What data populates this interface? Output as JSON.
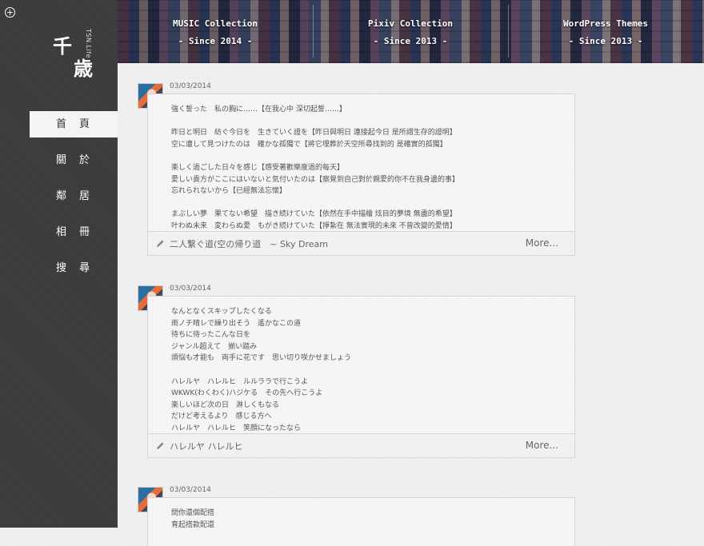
{
  "sidebar": {
    "add_icon": "+",
    "logo": {
      "char1": "千",
      "char2": "歳",
      "sub": "TSN.Life"
    },
    "nav": [
      {
        "label": "首頁",
        "active": true
      },
      {
        "label": "關於",
        "active": false
      },
      {
        "label": "鄰居",
        "active": false
      },
      {
        "label": "相冊",
        "active": false
      },
      {
        "label": "搜尋",
        "active": false
      }
    ]
  },
  "banner": [
    {
      "title": "MUSIC Collection",
      "since": "- Since 2014 -"
    },
    {
      "title": "Pixiv Collection",
      "since": "- Since 2013 -"
    },
    {
      "title": "WordPress Themes",
      "since": "- Since 2013 -"
    }
  ],
  "posts": [
    {
      "date": "03/03/2014",
      "lines": [
        "強く誓った　私の胸に……【在我心中 深切起誓……】",
        "",
        "昨日と明日　紡ぐ今日を　生きていく證を【昨日與明日 連接起今日 是所謂生存的證明】",
        "空に遭して見つけたのは　確かな孤獨で【將它埋葬於天空所尋找到的 是確實的孤獨】",
        "",
        "楽しく過ごした日々を感じ【感受著歡樂度過的每天】",
        "愛しい貴方がここにはいないと気付いたのは【察覺到自己對於親愛的你不在我身邊的事】",
        "忘れられないから【已經無法忘懷】",
        "",
        "まぶしい夢　果てない希望　描き続けていた【依然在手中描繪 炫目的夢境 無盡的希望】",
        "叶わぬ未来　変わらぬ愛　もがき続けていた【掙紮在 無法實現的未來 不曾改變的愛情】"
      ],
      "footer_title": "二人繋ぐ道(空の帰り道　~ Sky Dream",
      "more": "More..."
    },
    {
      "date": "03/03/2014",
      "lines": [
        "なんとなくスキップしたくなる",
        "雨ノチ晴レで繰り出そう　遙かなこの道",
        "待ちに待ったこんな日を",
        "ジャンル超えて　揃い踏み",
        "煩悩も才能も　両手に花です　思い切り咲かせましょう",
        "",
        "ハレルヤ　ハレルヒ　ルルララで行こうよ",
        "WKWK(わくわく)ハジケる　その先へ行こうよ",
        "楽しいほど次の日　淋しくもなる",
        "だけど考えるより　感じる方へ",
        "ハレルヤ　ハレルヒ　笑顔になったなら"
      ],
      "footer_title": "ハレルヤ ハレルヒ",
      "more": "More..."
    },
    {
      "date": "03/03/2014",
      "lines": [
        "問你還個配搭",
        "育起搭款配還"
      ],
      "footer_title": "",
      "more": ""
    }
  ]
}
